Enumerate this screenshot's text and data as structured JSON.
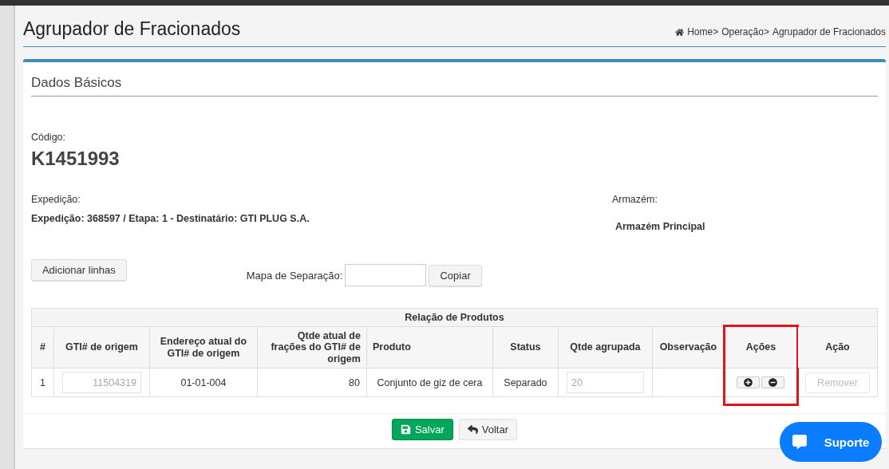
{
  "page": {
    "title": "Agrupador de Fracionados"
  },
  "breadcrumb": [
    "Home>",
    "Operação>",
    "Agrupador de Fracionados"
  ],
  "section": {
    "title": "Dados Básicos"
  },
  "code": {
    "label": "Código:",
    "value": "K1451993"
  },
  "shipment": {
    "label": "Expedição:",
    "value": "Expedição: 368597 / Etapa: 1 - Destinatário: GTI PLUG S.A."
  },
  "warehouse": {
    "label": "Armazém:",
    "value": "Armazém Principal"
  },
  "add_lines_button": "Adicionar linhas",
  "separation_map": {
    "label": "Mapa de Separação:",
    "button": "Copiar"
  },
  "table": {
    "caption": "Relação de Produtos",
    "columns": [
      {
        "label": "#",
        "highlighted": false
      },
      {
        "label": "GTI# de origem",
        "highlighted": false
      },
      {
        "label": "Endereço atual do GTI# de origem",
        "highlighted": false
      },
      {
        "label": "Qtde atual de frações do GTI# de origem",
        "highlighted": false
      },
      {
        "label": "Produto",
        "highlighted": false
      },
      {
        "label": "Status",
        "highlighted": false
      },
      {
        "label": "Qtde agrupada",
        "highlighted": false
      },
      {
        "label": "Observação",
        "highlighted": false
      },
      {
        "label": "Ações",
        "highlighted": true
      },
      {
        "label": "Ação",
        "highlighted": false
      }
    ],
    "rows": [
      {
        "number": "1",
        "gti": {
          "value": "11504319",
          "disabled": true
        },
        "address": "01-01-004",
        "fractions": "80",
        "product": "Conjunto de giz de cera",
        "status": "Separado",
        "grouped_qty": {
          "value": "20",
          "disabled": true
        },
        "remove_button": {
          "label": "Remover",
          "disabled": true
        }
      }
    ]
  },
  "footer_buttons": [
    {
      "kind": "save",
      "label": "Salvar"
    },
    {
      "kind": "back",
      "label": "Voltar"
    }
  ],
  "support_button": "Suporte"
}
